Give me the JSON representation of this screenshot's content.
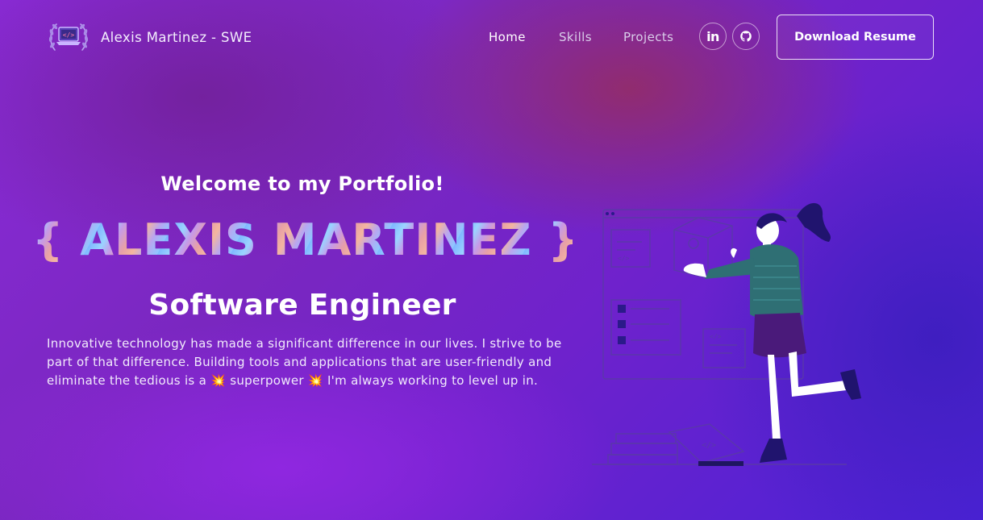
{
  "nav": {
    "brand_name": "Alexis Martinez - SWE",
    "links": [
      {
        "label": "Home"
      },
      {
        "label": "Skills"
      },
      {
        "label": "Projects"
      }
    ],
    "social": [
      {
        "icon": "linkedin-icon",
        "glyph": "in"
      },
      {
        "icon": "github-icon"
      }
    ],
    "resume_button": "Download Resume"
  },
  "hero": {
    "welcome": "Welcome to my Portfolio!",
    "name": "{ ALEXIS MARTINEZ }",
    "role": "Software Engineer",
    "bio": "Innovative technology has made a significant difference in our lives. I strive to be part of that difference. Building tools and applications that are user-friendly and eliminate the tedious is a 💥 superpower 💥 I'm always working to level up in."
  },
  "colors": {
    "accent_pink": "#e05a86",
    "bg_purple": "#7a27c0",
    "bg_blue": "#4b22d6",
    "jacket_teal": "#2f6f74"
  }
}
